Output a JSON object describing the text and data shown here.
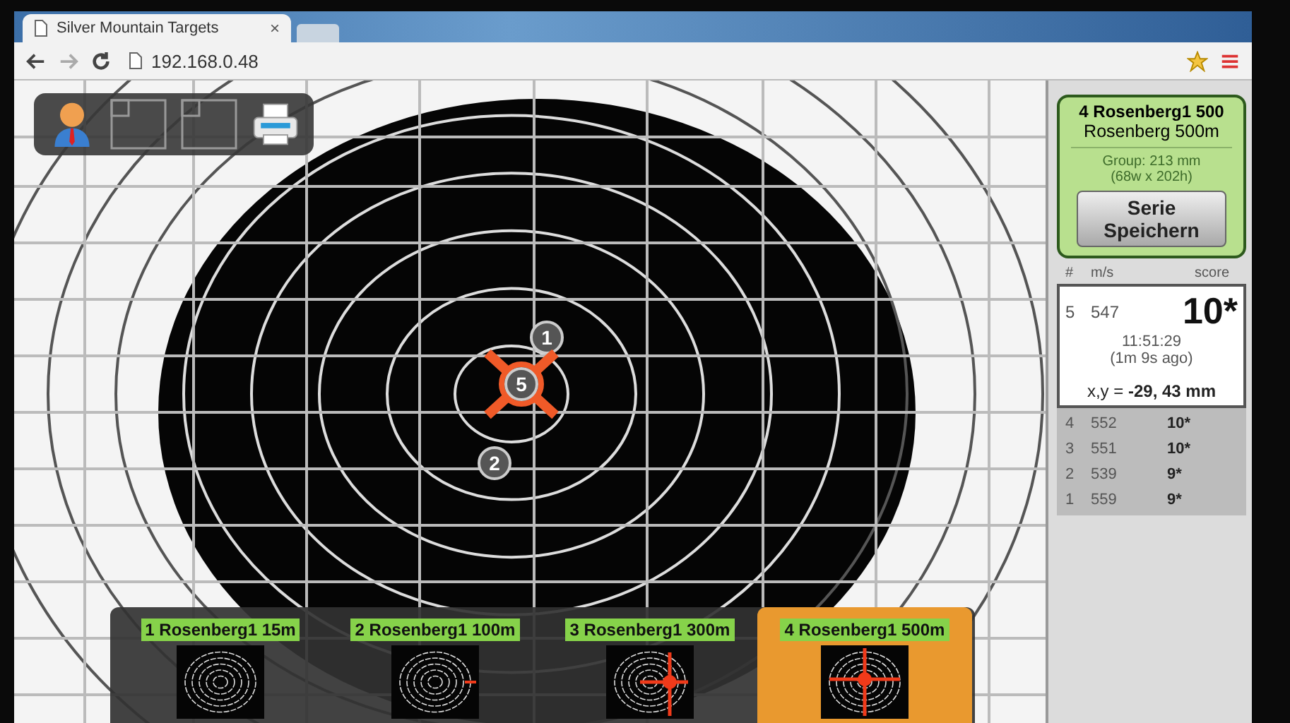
{
  "browser": {
    "tab_title": "Silver Mountain Targets",
    "tab_close": "×",
    "url": "192.168.0.48"
  },
  "target": {
    "shots": [
      {
        "label": "1",
        "selected": false
      },
      {
        "label": "5",
        "selected": true
      },
      {
        "label": "2",
        "selected": false
      }
    ]
  },
  "panel": {
    "title": "4 Rosenberg1 500",
    "subtitle": "Rosenberg 500m",
    "group": "Group: 213 mm",
    "group_dims": "(68w x 202h)",
    "save_button": "Serie Speichern",
    "columns": [
      "#",
      "m/s",
      "score"
    ],
    "current": {
      "number": "5",
      "speed": "547",
      "score": "10*",
      "time": "11:51:29",
      "ago": "(1m 9s ago)",
      "position": "x,y = **-29, 43 mm**"
    },
    "history": [
      {
        "number": "4",
        "speed": "552",
        "score": "10*"
      },
      {
        "number": "3",
        "speed": "551",
        "score": "10*"
      },
      {
        "number": "2",
        "speed": "539",
        "score": "9*"
      },
      {
        "number": "1",
        "speed": "559",
        "score": "9*"
      }
    ]
  },
  "series": [
    {
      "label": "1 Rosenberg1 15m",
      "selected": false,
      "kind": "empty"
    },
    {
      "label": "2 Rosenberg1 100m",
      "selected": false,
      "kind": "edge"
    },
    {
      "label": "3 Rosenberg1 300m",
      "selected": false,
      "kind": "cross-right"
    },
    {
      "label": "4 Rosenberg1 500m",
      "selected": true,
      "kind": "cross-center"
    }
  ]
}
